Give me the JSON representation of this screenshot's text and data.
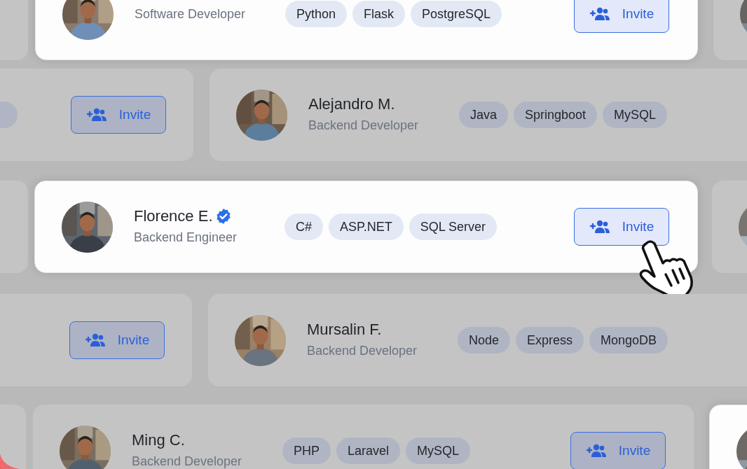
{
  "rows": [
    {
      "cards": [
        {
          "kind": "blank",
          "highlighted": false
        },
        {
          "kind": "profile",
          "highlighted": true,
          "role": "Software Developer",
          "tags": [
            "Python",
            "Flask",
            "PostgreSQL"
          ],
          "invite": "Invite"
        },
        {
          "kind": "avatar_stub",
          "highlighted": false
        }
      ]
    },
    {
      "cards": [
        {
          "kind": "invite_stub",
          "highlighted": false,
          "partial_tag": true,
          "invite": "Invite"
        },
        {
          "kind": "profile",
          "highlighted": false,
          "name": "Alejandro M.",
          "verified": false,
          "role": "Backend Developer",
          "tags": [
            "Java",
            "Springboot",
            "MySQL"
          ]
        }
      ]
    },
    {
      "cards": [
        {
          "kind": "blank",
          "highlighted": false
        },
        {
          "kind": "profile",
          "highlighted": true,
          "name": "Florence E.",
          "verified": true,
          "role": "Backend Engineer",
          "tags": [
            "C#",
            "ASP.NET",
            "SQL Server"
          ],
          "invite": "Invite",
          "cursor": true
        },
        {
          "kind": "avatar_stub",
          "highlighted": false
        }
      ]
    },
    {
      "cards": [
        {
          "kind": "invite_stub",
          "highlighted": false,
          "partial_tag": false,
          "invite": "Invite"
        },
        {
          "kind": "profile",
          "highlighted": false,
          "name": "Mursalin F.",
          "verified": false,
          "role": "Backend Developer",
          "tags": [
            "Node",
            "Express",
            "MongoDB"
          ]
        }
      ]
    },
    {
      "cards": [
        {
          "kind": "blank",
          "highlighted": false
        },
        {
          "kind": "profile",
          "highlighted": false,
          "name": "Ming C.",
          "verified": false,
          "role": "Backend Developer",
          "tags": [
            "PHP",
            "Laravel",
            "MySQL"
          ],
          "invite": "Invite"
        },
        {
          "kind": "avatar_stub",
          "highlighted": true
        }
      ]
    }
  ]
}
